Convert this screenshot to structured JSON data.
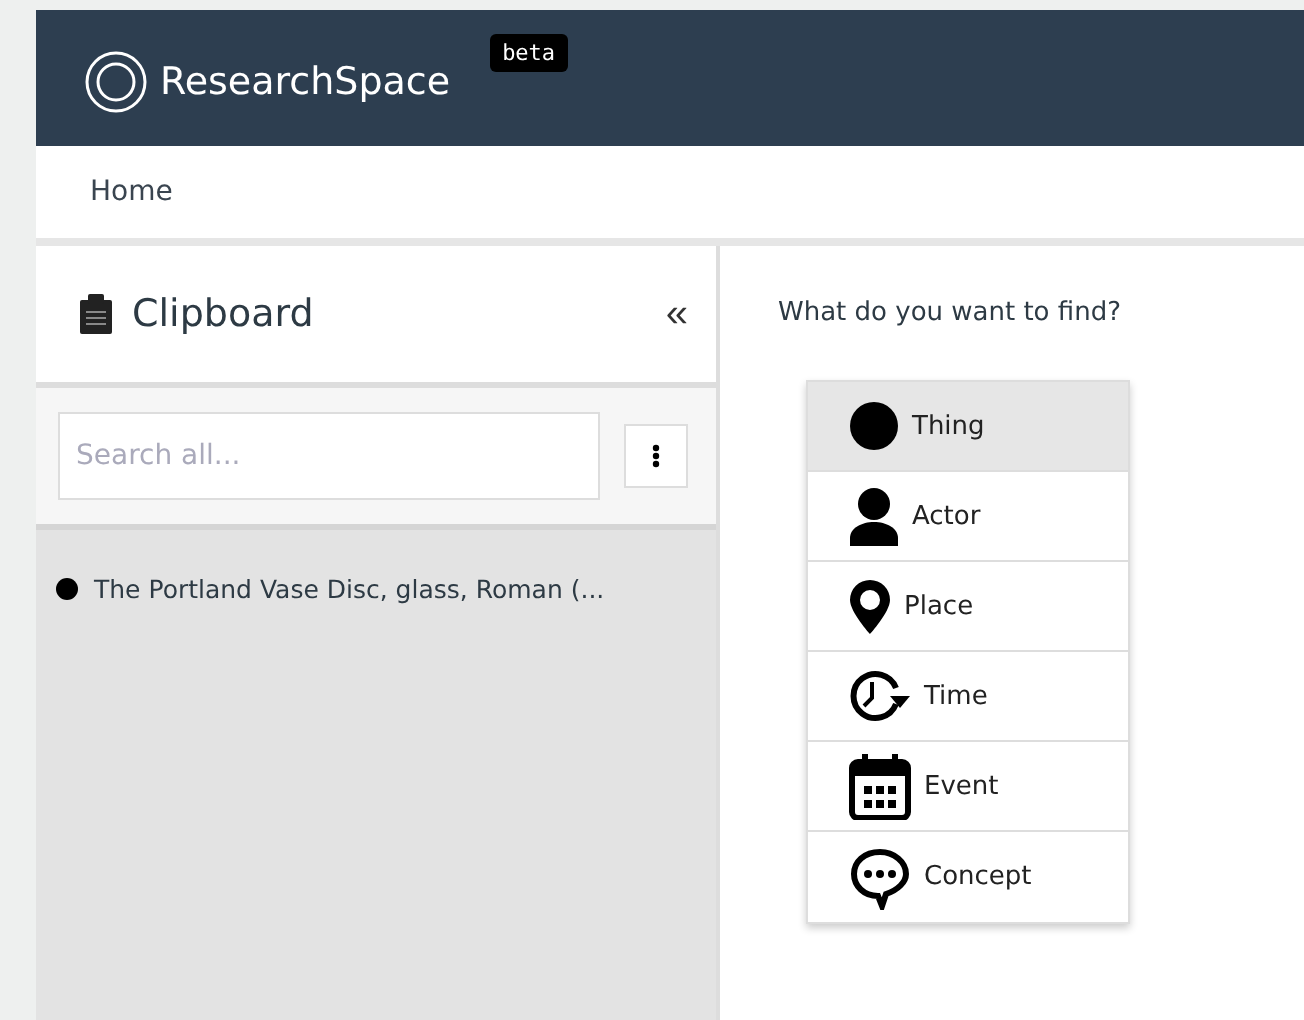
{
  "header": {
    "logo": "ResearchSpace",
    "badge": "beta"
  },
  "nav": {
    "items": [
      "Home"
    ]
  },
  "clipboard": {
    "title": "Clipboard",
    "collapse": "«",
    "search": {
      "placeholder": "Search all..."
    },
    "items": [
      {
        "label": "The Portland Vase Disc, glass, Roman (..."
      }
    ]
  },
  "finder": {
    "question": "What do you want to find?",
    "options": [
      {
        "kind": "thing",
        "label": "Thing",
        "selected": true
      },
      {
        "kind": "actor",
        "label": "Actor",
        "selected": false
      },
      {
        "kind": "place",
        "label": "Place",
        "selected": false
      },
      {
        "kind": "time",
        "label": "Time",
        "selected": false
      },
      {
        "kind": "event",
        "label": "Event",
        "selected": false
      },
      {
        "kind": "concept",
        "label": "Concept",
        "selected": false
      }
    ]
  }
}
